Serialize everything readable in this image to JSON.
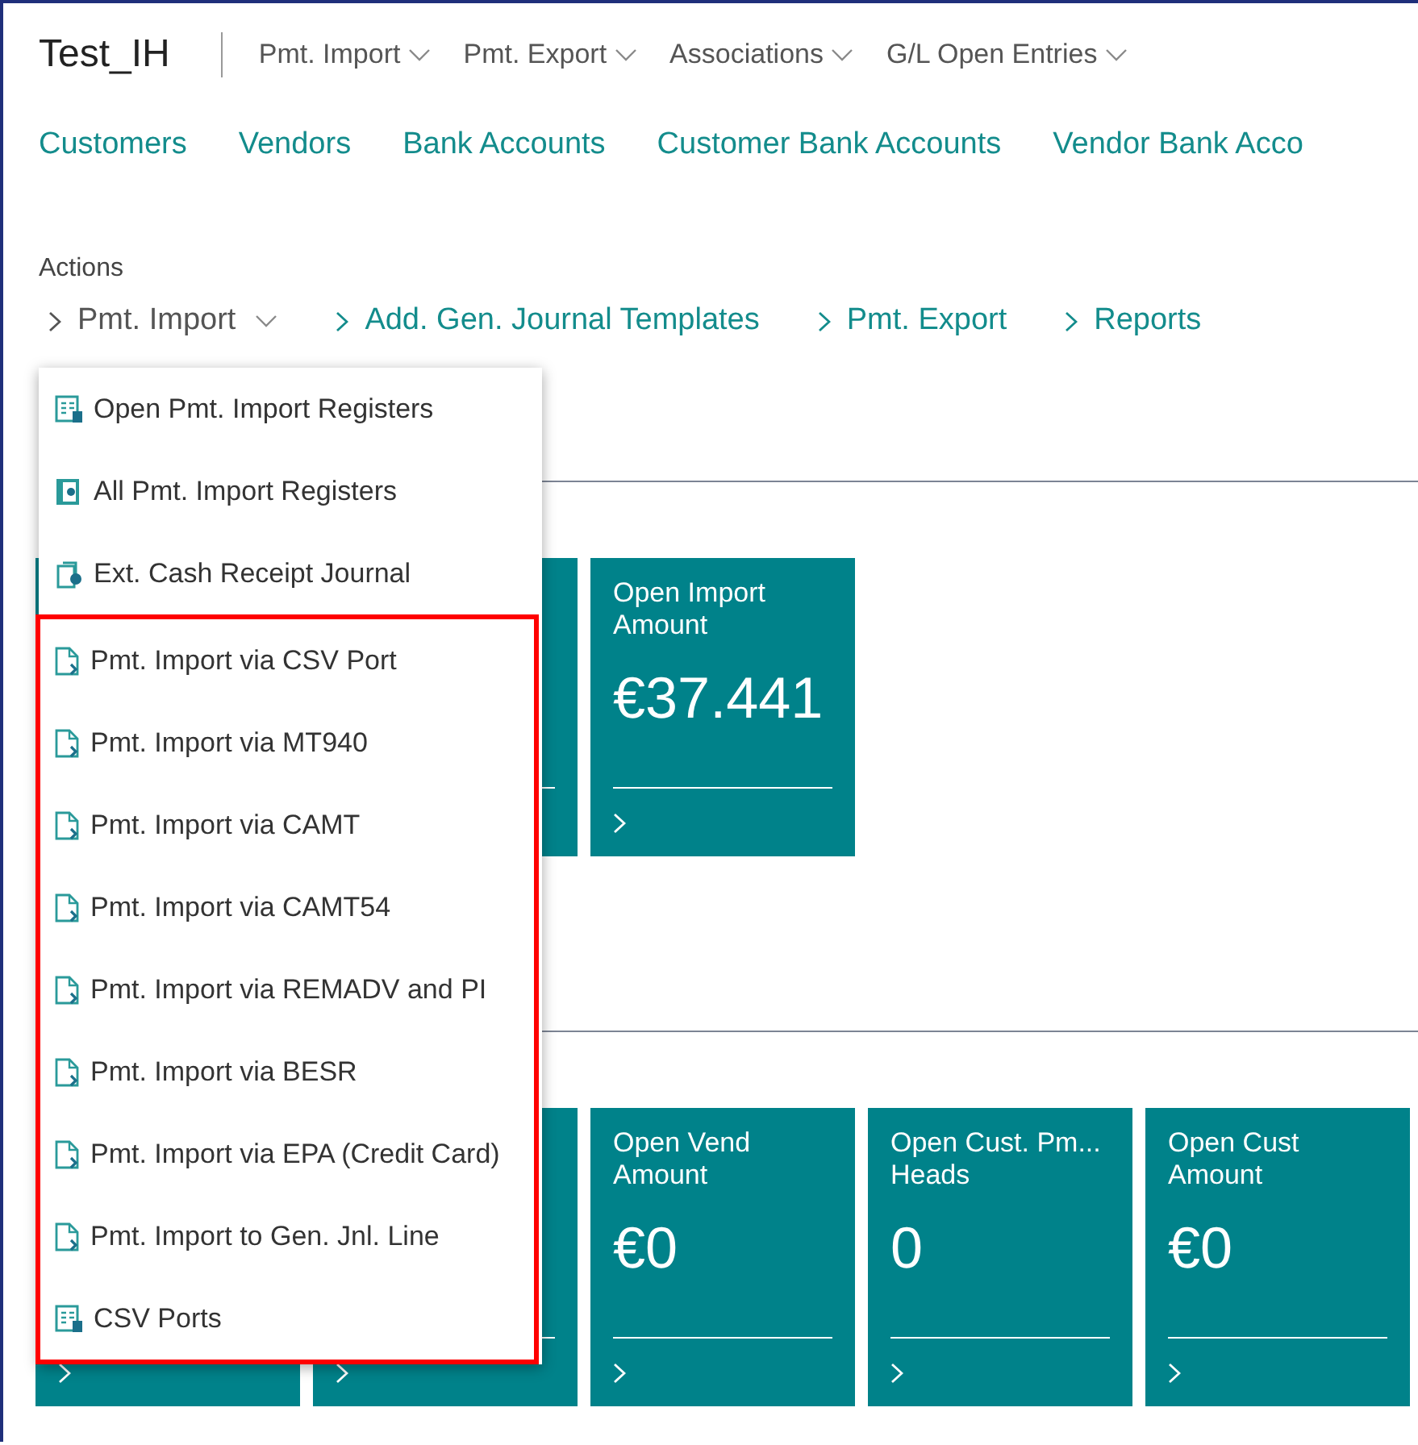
{
  "header": {
    "title": "Test_IH",
    "menus": [
      {
        "label": "Pmt. Import"
      },
      {
        "label": "Pmt. Export"
      },
      {
        "label": "Associations"
      },
      {
        "label": "G/L Open Entries"
      }
    ]
  },
  "nav_links": [
    "Customers",
    "Vendors",
    "Bank Accounts",
    "Customer Bank Accounts",
    "Vendor Bank Acco"
  ],
  "actions": {
    "label": "Actions",
    "items": [
      {
        "label": "Pmt. Import",
        "expanded": true
      },
      {
        "label": "Add. Gen. Journal Templates",
        "expanded": false
      },
      {
        "label": "Pmt. Export",
        "expanded": false
      },
      {
        "label": "Reports",
        "expanded": false
      }
    ]
  },
  "dropdown": {
    "items": [
      {
        "label": "Open Pmt. Import Registers",
        "kind": "register"
      },
      {
        "label": "All Pmt. Import Registers",
        "kind": "book"
      },
      {
        "label": "Ext. Cash Receipt Journal",
        "kind": "journal"
      }
    ],
    "highlighted_items": [
      {
        "label": "Pmt. Import via CSV Port",
        "kind": "import"
      },
      {
        "label": "Pmt. Import via MT940",
        "kind": "import"
      },
      {
        "label": "Pmt. Import via CAMT",
        "kind": "import"
      },
      {
        "label": "Pmt. Import via CAMT54",
        "kind": "import"
      },
      {
        "label": "Pmt. Import via REMADV and PI",
        "kind": "import"
      },
      {
        "label": "Pmt. Import via BESR",
        "kind": "import"
      },
      {
        "label": "Pmt. Import via EPA (Credit Card)",
        "kind": "import"
      },
      {
        "label": "Pmt. Import to Gen. Jnl. Line",
        "kind": "import"
      },
      {
        "label": "CSV Ports",
        "kind": "register"
      }
    ]
  },
  "tile_rows": [
    {
      "tiles": [
        {
          "kind": "blank"
        },
        {
          "kind": "blank"
        },
        {
          "kind": "full",
          "title": "Open Import Amount",
          "value": "€37.441"
        }
      ]
    },
    {
      "tiles": [
        {
          "kind": "covered"
        },
        {
          "kind": "covered"
        },
        {
          "kind": "full",
          "title": "Open Vend Amount",
          "value": "€0"
        },
        {
          "kind": "full",
          "title": "Open Cust. Pm... Heads",
          "value": "0"
        },
        {
          "kind": "full",
          "title": "Open Cust Amount",
          "value": "€0"
        }
      ]
    }
  ]
}
